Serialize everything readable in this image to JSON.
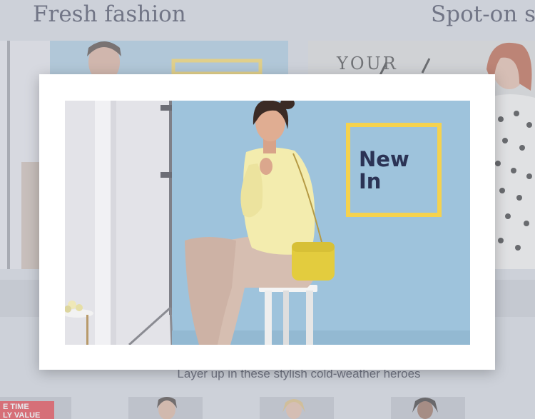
{
  "background": {
    "section_titles": [
      "Fresh fashion",
      "Spot-on sty"
    ],
    "card_2_text": "YOUR",
    "subtitle": "Layer up in these stylish cold-weather heroes",
    "badge": "E TIME\nLY VALUE"
  },
  "modal": {
    "image_label_line1": "New",
    "image_label_line2": "In"
  },
  "colors": {
    "sky_blue": "#9ec3dc",
    "label_yellow": "#f5d24e",
    "label_text": "#2b3355",
    "badge_red": "#e2242c"
  }
}
